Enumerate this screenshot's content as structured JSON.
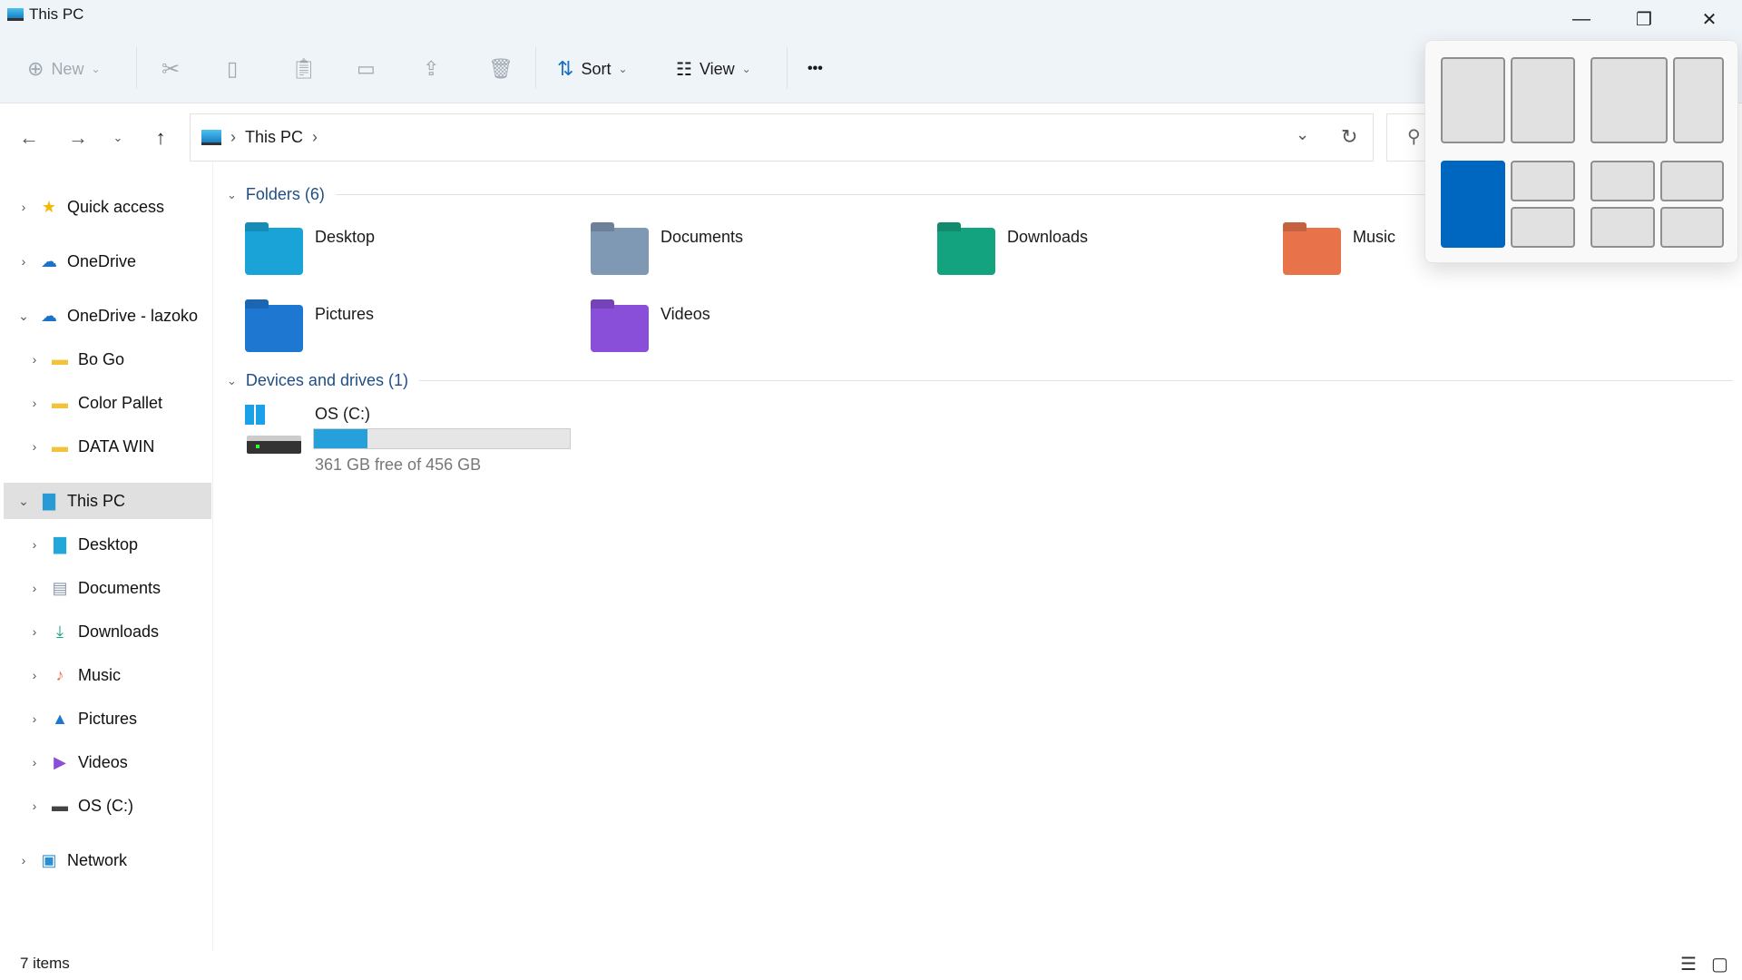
{
  "window": {
    "title": "This PC"
  },
  "toolbar": {
    "new_label": "New",
    "sort_label": "Sort",
    "view_label": "View",
    "more": "•••"
  },
  "address": {
    "path": [
      "This PC"
    ]
  },
  "sidebar": {
    "items": [
      {
        "label": "Quick access",
        "icon": "star-icon"
      },
      {
        "label": "OneDrive",
        "icon": "cloud-icon"
      },
      {
        "label": "OneDrive - lazoko",
        "icon": "cloud-icon"
      },
      {
        "label": "Bo Go",
        "icon": "folder-icon"
      },
      {
        "label": "Color Pallet",
        "icon": "folder-icon"
      },
      {
        "label": "DATA WIN",
        "icon": "folder-icon"
      },
      {
        "label": "This PC",
        "icon": "computer-icon"
      },
      {
        "label": "Desktop",
        "icon": "desktop-icon"
      },
      {
        "label": "Documents",
        "icon": "documents-icon"
      },
      {
        "label": "Downloads",
        "icon": "download-icon"
      },
      {
        "label": "Music",
        "icon": "music-icon"
      },
      {
        "label": "Pictures",
        "icon": "pictures-icon"
      },
      {
        "label": "Videos",
        "icon": "videos-icon"
      },
      {
        "label": "OS (C:)",
        "icon": "drive-icon"
      },
      {
        "label": "Network",
        "icon": "network-icon"
      }
    ]
  },
  "main": {
    "folders_header": "Folders (6)",
    "folders": [
      {
        "label": "Desktop",
        "color": "#1aa3d6"
      },
      {
        "label": "Documents",
        "color": "#7f98b3"
      },
      {
        "label": "Downloads",
        "color": "#14a37f"
      },
      {
        "label": "Music",
        "color": "#e8734a"
      },
      {
        "label": "Pictures",
        "color": "#1e78d2"
      },
      {
        "label": "Videos",
        "color": "#8a4fd8"
      }
    ],
    "drives_header": "Devices and drives (1)",
    "drive": {
      "name": "OS (C:)",
      "free_text": "361 GB free of 456 GB",
      "used_percent": 21
    }
  },
  "status": {
    "items": "7 items"
  },
  "colors": {
    "accent": "#0067c0",
    "bar": "#26a0da"
  }
}
